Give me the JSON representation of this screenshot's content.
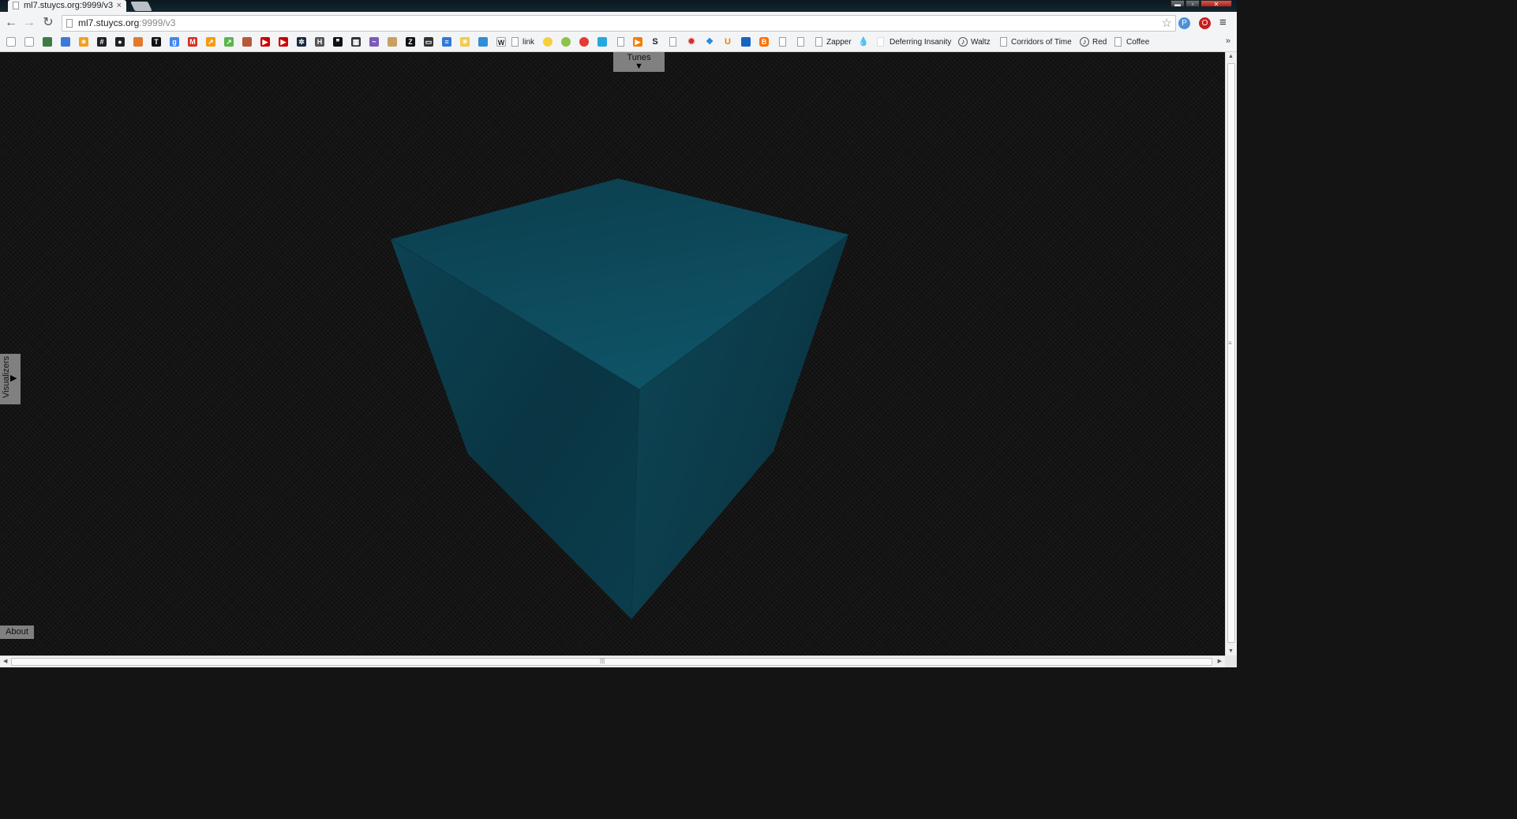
{
  "browser": {
    "tab_title": "ml7.stuycs.org:9999/v3",
    "tab_close": "×",
    "address": {
      "host": "ml7.stuycs.org",
      "rest": ":9999/v3"
    },
    "back": "←",
    "forward": "→",
    "reload": "↻",
    "star": "☆",
    "ext1": "P",
    "ext2": "O",
    "menu": "≡",
    "window_controls": {
      "minimize": "▬",
      "maximize": "▫",
      "close": "✕"
    }
  },
  "bookmarks": {
    "icon_items": [
      {
        "name": "page-icon",
        "color": "#ffffff",
        "glyph": ""
      },
      {
        "name": "page-icon",
        "color": "#ffffff",
        "glyph": ""
      },
      {
        "name": "photo-icon",
        "color": "#3d7a46",
        "glyph": ""
      },
      {
        "name": "calendar-icon",
        "color": "#3d79d8",
        "glyph": ""
      },
      {
        "name": "sparkle-icon",
        "color": "#f0a020",
        "glyph": "✶"
      },
      {
        "name": "hash-icon",
        "color": "#222222",
        "glyph": "#"
      },
      {
        "name": "github-icon",
        "color": "#222222",
        "glyph": "●"
      },
      {
        "name": "orange-logo-icon",
        "color": "#e07b2e",
        "glyph": ""
      },
      {
        "name": "nytimes-icon",
        "color": "#111111",
        "glyph": "T"
      },
      {
        "name": "google-icon",
        "color": "#4285f4",
        "glyph": "g"
      },
      {
        "name": "gmail-icon",
        "color": "#d93025",
        "glyph": "M"
      },
      {
        "name": "chart-icon",
        "color": "#f39c12",
        "glyph": "↗"
      },
      {
        "name": "green-chart-icon",
        "color": "#56b847",
        "glyph": "↗"
      },
      {
        "name": "book-icon",
        "color": "#b55a3a",
        "glyph": ""
      },
      {
        "name": "youtube-icon",
        "color": "#cc0000",
        "glyph": "▶"
      },
      {
        "name": "youtube-icon",
        "color": "#cc0000",
        "glyph": "▶"
      },
      {
        "name": "snowflake-icon",
        "color": "#1a2a44",
        "glyph": "✲"
      },
      {
        "name": "hr-icon",
        "color": "#555555",
        "glyph": "H"
      },
      {
        "name": "quote-icon",
        "color": "#111111",
        "glyph": "❞"
      },
      {
        "name": "qr-icon",
        "color": "#333333",
        "glyph": "▦"
      },
      {
        "name": "purple-bird-icon",
        "color": "#7b5bb5",
        "glyph": "~"
      },
      {
        "name": "bottle-icon",
        "color": "#c8a060",
        "glyph": ""
      },
      {
        "name": "zotero-icon",
        "color": "#111111",
        "glyph": "Z"
      },
      {
        "name": "printer-icon",
        "color": "#333333",
        "glyph": "▭"
      },
      {
        "name": "stack-icon",
        "color": "#2e7bd6",
        "glyph": "≡"
      },
      {
        "name": "sun-icon",
        "color": "#f2c94c",
        "glyph": "☀"
      },
      {
        "name": "blue-square-icon",
        "color": "#2f8fd4",
        "glyph": ""
      },
      {
        "name": "wikipedia-icon",
        "color": "#ffffff",
        "glyph": "W"
      }
    ],
    "text_items": [
      "link",
      "Zapper",
      "Deferring Insanity",
      "Waltz",
      "Corridors of Time",
      "Red",
      "Coffee"
    ],
    "overflow": "»"
  },
  "page": {
    "tunes_label": "Tunes",
    "tunes_arrow": "▼",
    "visualizers_label": "Visualizers",
    "visualizers_arrow": "▶",
    "about_label": "About",
    "cube": {
      "top_color": "#0e4a5b",
      "left_color": "#0a3442",
      "right_color": "#0c3b4a"
    }
  },
  "scrollbars": {
    "up": "▲",
    "down": "▼",
    "left": "◀",
    "right": "▶",
    "grip_v": "≡",
    "grip_h": "|||"
  }
}
